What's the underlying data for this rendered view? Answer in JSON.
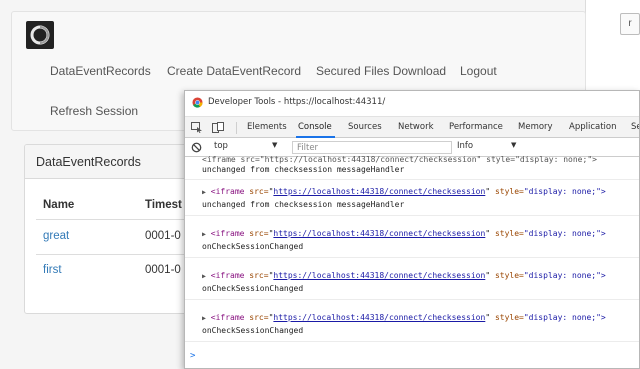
{
  "app": {
    "nav": [
      "DataEventRecords",
      "Create DataEventRecord",
      "Secured Files Download",
      "Logout",
      "Refresh Session"
    ],
    "panel_title": "DataEventRecords",
    "table": {
      "headers": [
        "Name",
        "Timest"
      ],
      "rows": [
        {
          "name": "great",
          "timestamp": "0001-0"
        },
        {
          "name": "first",
          "timestamp": "0001-0"
        }
      ]
    },
    "scroll_glyph": "r"
  },
  "devtools": {
    "title": "Developer Tools - https://localhost:44311/",
    "tabs": [
      "Elements",
      "Console",
      "Sources",
      "Network",
      "Performance",
      "Memory",
      "Application",
      "Se"
    ],
    "active_tab": "Console",
    "context": "top",
    "filter_placeholder": "Filter",
    "level": "Info",
    "iframe_tag": "<iframe",
    "iframe_src_attr": "src=",
    "iframe_url": "https://localhost:44318/connect/checksession",
    "iframe_style_attr": "style=",
    "iframe_style_val": "\"display: none;\">",
    "partial_line": "<iframe src=\"https://localhost:44318/connect/checksession\" style=\"display: none;\">",
    "messages": [
      "unchanged from checksession messageHandler",
      "unchanged from checksession messageHandler",
      "onCheckSessionChanged",
      "onCheckSessionChanged",
      "onCheckSessionChanged"
    ],
    "prompt": ">"
  },
  "colors": {
    "link": "#337ab7",
    "active_tab_underline": "#1a73e8",
    "tag": "#881280",
    "attr": "#994500",
    "value": "#1a1aa6"
  }
}
